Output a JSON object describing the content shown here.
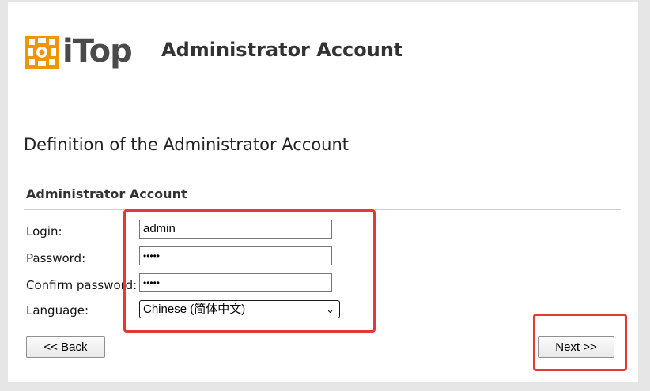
{
  "header": {
    "logo_text": "iTop",
    "title": "Administrator Account"
  },
  "section": {
    "title": "Definition of the Administrator Account"
  },
  "fieldset": {
    "title": "Administrator Account"
  },
  "form": {
    "login": {
      "label": "Login:",
      "value": "admin"
    },
    "password": {
      "label": "Password:",
      "value": "•••••"
    },
    "confirm_password": {
      "label": "Confirm password:",
      "value": "•••••"
    },
    "language": {
      "label": "Language:",
      "value": "Chinese (简体中文)"
    }
  },
  "buttons": {
    "back": "<< Back",
    "next": "Next >>"
  },
  "colors": {
    "logo_orange": "#f29400",
    "highlight": "#e53935"
  }
}
